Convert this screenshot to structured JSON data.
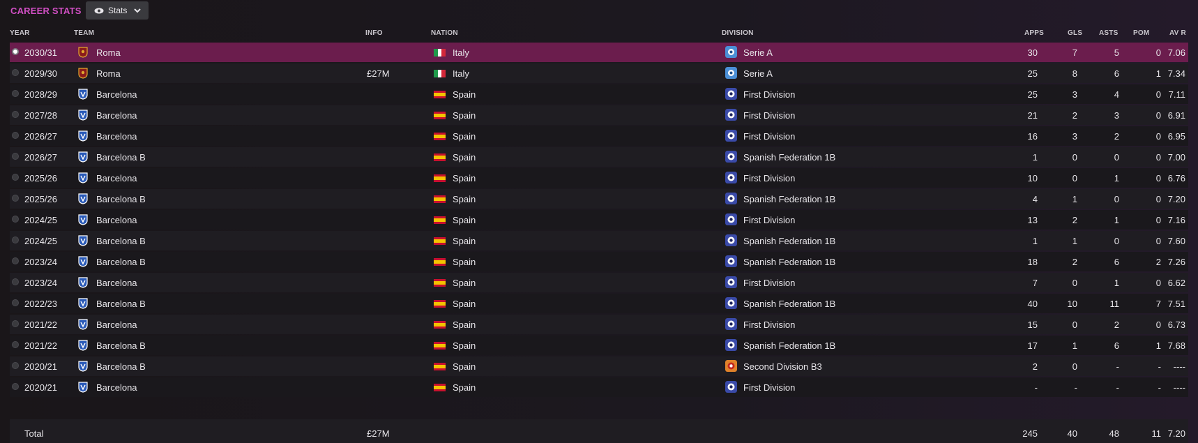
{
  "title": "CAREER STATS",
  "view_button": {
    "label": "Stats",
    "icon": "eye-icon"
  },
  "columns": {
    "year": "YEAR",
    "team": "TEAM",
    "info": "INFO",
    "nation": "NATION",
    "division": "DIVISION",
    "apps": "APPS",
    "gls": "GLS",
    "asts": "ASTS",
    "pom": "POM",
    "avr": "AV R"
  },
  "rows": [
    {
      "year": "2030/31",
      "team": "Roma",
      "info": "",
      "nation": "Italy",
      "division": "Serie A",
      "apps": "30",
      "gls": "7",
      "asts": "5",
      "pom": "0",
      "avr": "7.06",
      "club": "roma",
      "flag": "italy",
      "div_icon": "serie-a",
      "selected": true
    },
    {
      "year": "2029/30",
      "team": "Roma",
      "info": "£27M",
      "nation": "Italy",
      "division": "Serie A",
      "apps": "25",
      "gls": "8",
      "asts": "6",
      "pom": "1",
      "avr": "7.34",
      "club": "roma",
      "flag": "italy",
      "div_icon": "serie-a"
    },
    {
      "year": "2028/29",
      "team": "Barcelona",
      "info": "",
      "nation": "Spain",
      "division": "First Division",
      "apps": "25",
      "gls": "3",
      "asts": "4",
      "pom": "0",
      "avr": "7.11",
      "club": "barcelona",
      "flag": "spain",
      "div_icon": "first-division"
    },
    {
      "year": "2027/28",
      "team": "Barcelona",
      "info": "",
      "nation": "Spain",
      "division": "First Division",
      "apps": "21",
      "gls": "2",
      "asts": "3",
      "pom": "0",
      "avr": "6.91",
      "club": "barcelona",
      "flag": "spain",
      "div_icon": "first-division"
    },
    {
      "year": "2026/27",
      "team": "Barcelona",
      "info": "",
      "nation": "Spain",
      "division": "First Division",
      "apps": "16",
      "gls": "3",
      "asts": "2",
      "pom": "0",
      "avr": "6.95",
      "club": "barcelona",
      "flag": "spain",
      "div_icon": "first-division"
    },
    {
      "year": "2026/27",
      "team": "Barcelona B",
      "info": "",
      "nation": "Spain",
      "division": "Spanish Federation 1B",
      "apps": "1",
      "gls": "0",
      "asts": "0",
      "pom": "0",
      "avr": "7.00",
      "club": "barcelona",
      "flag": "spain",
      "div_icon": "first-division"
    },
    {
      "year": "2025/26",
      "team": "Barcelona",
      "info": "",
      "nation": "Spain",
      "division": "First Division",
      "apps": "10",
      "gls": "0",
      "asts": "1",
      "pom": "0",
      "avr": "6.76",
      "club": "barcelona",
      "flag": "spain",
      "div_icon": "first-division"
    },
    {
      "year": "2025/26",
      "team": "Barcelona B",
      "info": "",
      "nation": "Spain",
      "division": "Spanish Federation 1B",
      "apps": "4",
      "gls": "1",
      "asts": "0",
      "pom": "0",
      "avr": "7.20",
      "club": "barcelona",
      "flag": "spain",
      "div_icon": "first-division"
    },
    {
      "year": "2024/25",
      "team": "Barcelona",
      "info": "",
      "nation": "Spain",
      "division": "First Division",
      "apps": "13",
      "gls": "2",
      "asts": "1",
      "pom": "0",
      "avr": "7.16",
      "club": "barcelona",
      "flag": "spain",
      "div_icon": "first-division"
    },
    {
      "year": "2024/25",
      "team": "Barcelona B",
      "info": "",
      "nation": "Spain",
      "division": "Spanish Federation 1B",
      "apps": "1",
      "gls": "1",
      "asts": "0",
      "pom": "0",
      "avr": "7.60",
      "club": "barcelona",
      "flag": "spain",
      "div_icon": "first-division"
    },
    {
      "year": "2023/24",
      "team": "Barcelona B",
      "info": "",
      "nation": "Spain",
      "division": "Spanish Federation 1B",
      "apps": "18",
      "gls": "2",
      "asts": "6",
      "pom": "2",
      "avr": "7.26",
      "club": "barcelona",
      "flag": "spain",
      "div_icon": "first-division"
    },
    {
      "year": "2023/24",
      "team": "Barcelona",
      "info": "",
      "nation": "Spain",
      "division": "First Division",
      "apps": "7",
      "gls": "0",
      "asts": "1",
      "pom": "0",
      "avr": "6.62",
      "club": "barcelona",
      "flag": "spain",
      "div_icon": "first-division"
    },
    {
      "year": "2022/23",
      "team": "Barcelona B",
      "info": "",
      "nation": "Spain",
      "division": "Spanish Federation 1B",
      "apps": "40",
      "gls": "10",
      "asts": "11",
      "pom": "7",
      "avr": "7.51",
      "club": "barcelona",
      "flag": "spain",
      "div_icon": "first-division"
    },
    {
      "year": "2021/22",
      "team": "Barcelona",
      "info": "",
      "nation": "Spain",
      "division": "First Division",
      "apps": "15",
      "gls": "0",
      "asts": "2",
      "pom": "0",
      "avr": "6.73",
      "club": "barcelona",
      "flag": "spain",
      "div_icon": "first-division"
    },
    {
      "year": "2021/22",
      "team": "Barcelona B",
      "info": "",
      "nation": "Spain",
      "division": "Spanish Federation 1B",
      "apps": "17",
      "gls": "1",
      "asts": "6",
      "pom": "1",
      "avr": "7.68",
      "club": "barcelona",
      "flag": "spain",
      "div_icon": "first-division"
    },
    {
      "year": "2020/21",
      "team": "Barcelona B",
      "info": "",
      "nation": "Spain",
      "division": "Second Division B3",
      "apps": "2",
      "gls": "0",
      "asts": "-",
      "pom": "-",
      "avr": "----",
      "club": "barcelona",
      "flag": "spain",
      "div_icon": "second-division"
    },
    {
      "year": "2020/21",
      "team": "Barcelona",
      "info": "",
      "nation": "Spain",
      "division": "First Division",
      "apps": "-",
      "gls": "-",
      "asts": "-",
      "pom": "-",
      "avr": "----",
      "club": "barcelona",
      "flag": "spain",
      "div_icon": "first-division"
    }
  ],
  "total": {
    "label": "Total",
    "info": "£27M",
    "apps": "245",
    "gls": "40",
    "asts": "48",
    "pom": "11",
    "avr": "7.20"
  },
  "colors": {
    "accent": "#d14fc4",
    "selected_row": "#6b1d4d"
  }
}
